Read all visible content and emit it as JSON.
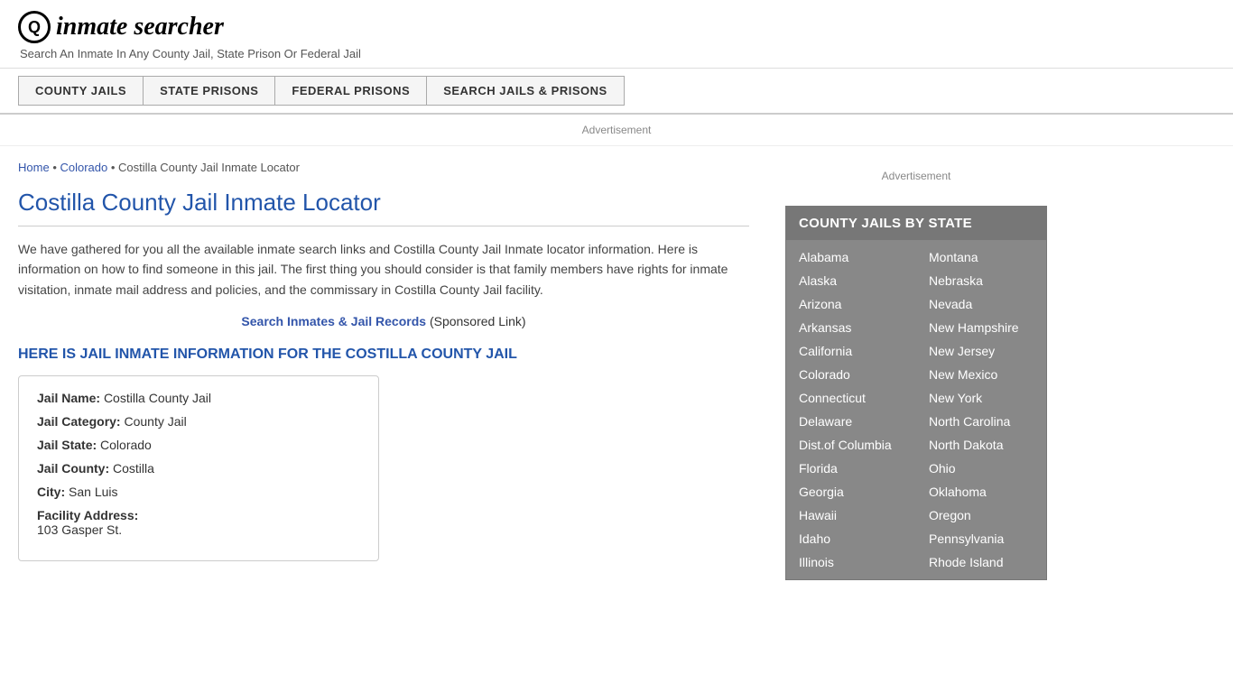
{
  "header": {
    "logo_icon": "🔍",
    "logo_text": "inmate searcher",
    "tagline": "Search An Inmate In Any County Jail, State Prison Or Federal Jail"
  },
  "nav": {
    "buttons": [
      {
        "label": "COUNTY JAILS",
        "id": "county-jails"
      },
      {
        "label": "STATE PRISONS",
        "id": "state-prisons"
      },
      {
        "label": "FEDERAL PRISONS",
        "id": "federal-prisons"
      },
      {
        "label": "SEARCH JAILS & PRISONS",
        "id": "search-jails"
      }
    ]
  },
  "ad": {
    "label": "Advertisement"
  },
  "breadcrumb": {
    "home": "Home",
    "state": "Colorado",
    "current": "Costilla County Jail Inmate Locator"
  },
  "content": {
    "title": "Costilla County Jail Inmate Locator",
    "description": "We have gathered for you all the available inmate search links and Costilla County Jail Inmate locator information. Here is information on how to find someone in this jail. The first thing you should consider is that family members have rights for inmate visitation, inmate mail address and policies, and the commissary in Costilla County Jail facility.",
    "sponsored_link": "Search Inmates & Jail Records",
    "sponsored_note": "(Sponsored Link)",
    "info_heading": "HERE IS JAIL INMATE INFORMATION FOR THE COSTILLA COUNTY JAIL",
    "info": {
      "jail_name_label": "Jail Name:",
      "jail_name_value": "Costilla County Jail",
      "jail_category_label": "Jail Category:",
      "jail_category_value": "County Jail",
      "jail_state_label": "Jail State:",
      "jail_state_value": "Colorado",
      "jail_county_label": "Jail County:",
      "jail_county_value": "Costilla",
      "city_label": "City:",
      "city_value": "San Luis",
      "address_label": "Facility Address:",
      "address_value": "103 Gasper St."
    }
  },
  "sidebar": {
    "ad_label": "Advertisement",
    "state_box_title": "COUNTY JAILS BY STATE",
    "states_left": [
      "Alabama",
      "Alaska",
      "Arizona",
      "Arkansas",
      "California",
      "Colorado",
      "Connecticut",
      "Delaware",
      "Dist.of Columbia",
      "Florida",
      "Georgia",
      "Hawaii",
      "Idaho",
      "Illinois"
    ],
    "states_right": [
      "Montana",
      "Nebraska",
      "Nevada",
      "New Hampshire",
      "New Jersey",
      "New Mexico",
      "New York",
      "North Carolina",
      "North Dakota",
      "Ohio",
      "Oklahoma",
      "Oregon",
      "Pennsylvania",
      "Rhode Island"
    ]
  }
}
